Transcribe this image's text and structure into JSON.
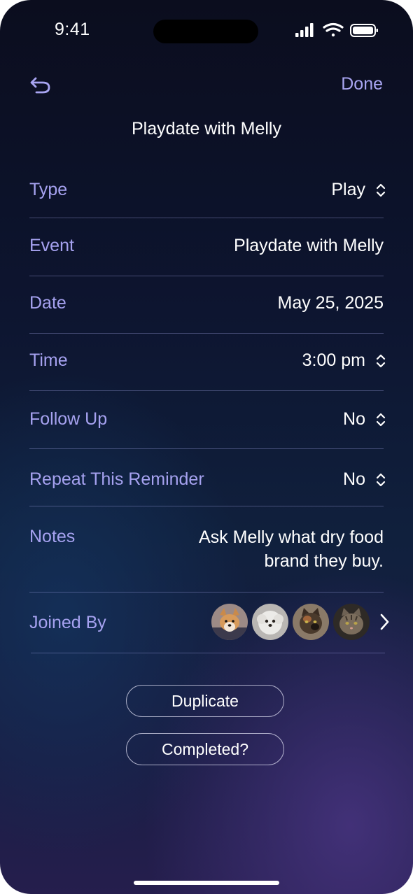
{
  "status_bar": {
    "time": "9:41"
  },
  "nav": {
    "done_label": "Done",
    "back_icon": "undo-arrow-icon"
  },
  "title": "Playdate with Melly",
  "rows": {
    "type": {
      "label": "Type",
      "value": "Play"
    },
    "event": {
      "label": "Event",
      "value": "Playdate with Melly"
    },
    "date": {
      "label": "Date",
      "value": "May 25, 2025"
    },
    "time": {
      "label": "Time",
      "value": "3:00 pm"
    },
    "follow_up": {
      "label": "Follow Up",
      "value": "No"
    },
    "repeat": {
      "label": "Repeat This Reminder",
      "value": "No"
    },
    "notes": {
      "label": "Notes",
      "value": "Ask Melly what dry food brand they buy."
    },
    "joined_by": {
      "label": "Joined By",
      "avatars": [
        "corgi-dog-avatar",
        "white-fluffy-dog-avatar",
        "tortoiseshell-cat-avatar",
        "tabby-cat-avatar"
      ]
    }
  },
  "buttons": {
    "duplicate": "Duplicate",
    "completed": "Completed?"
  },
  "colors": {
    "accent": "#a9a5f2",
    "label": "#a6a2f0",
    "text": "#ffffff"
  }
}
